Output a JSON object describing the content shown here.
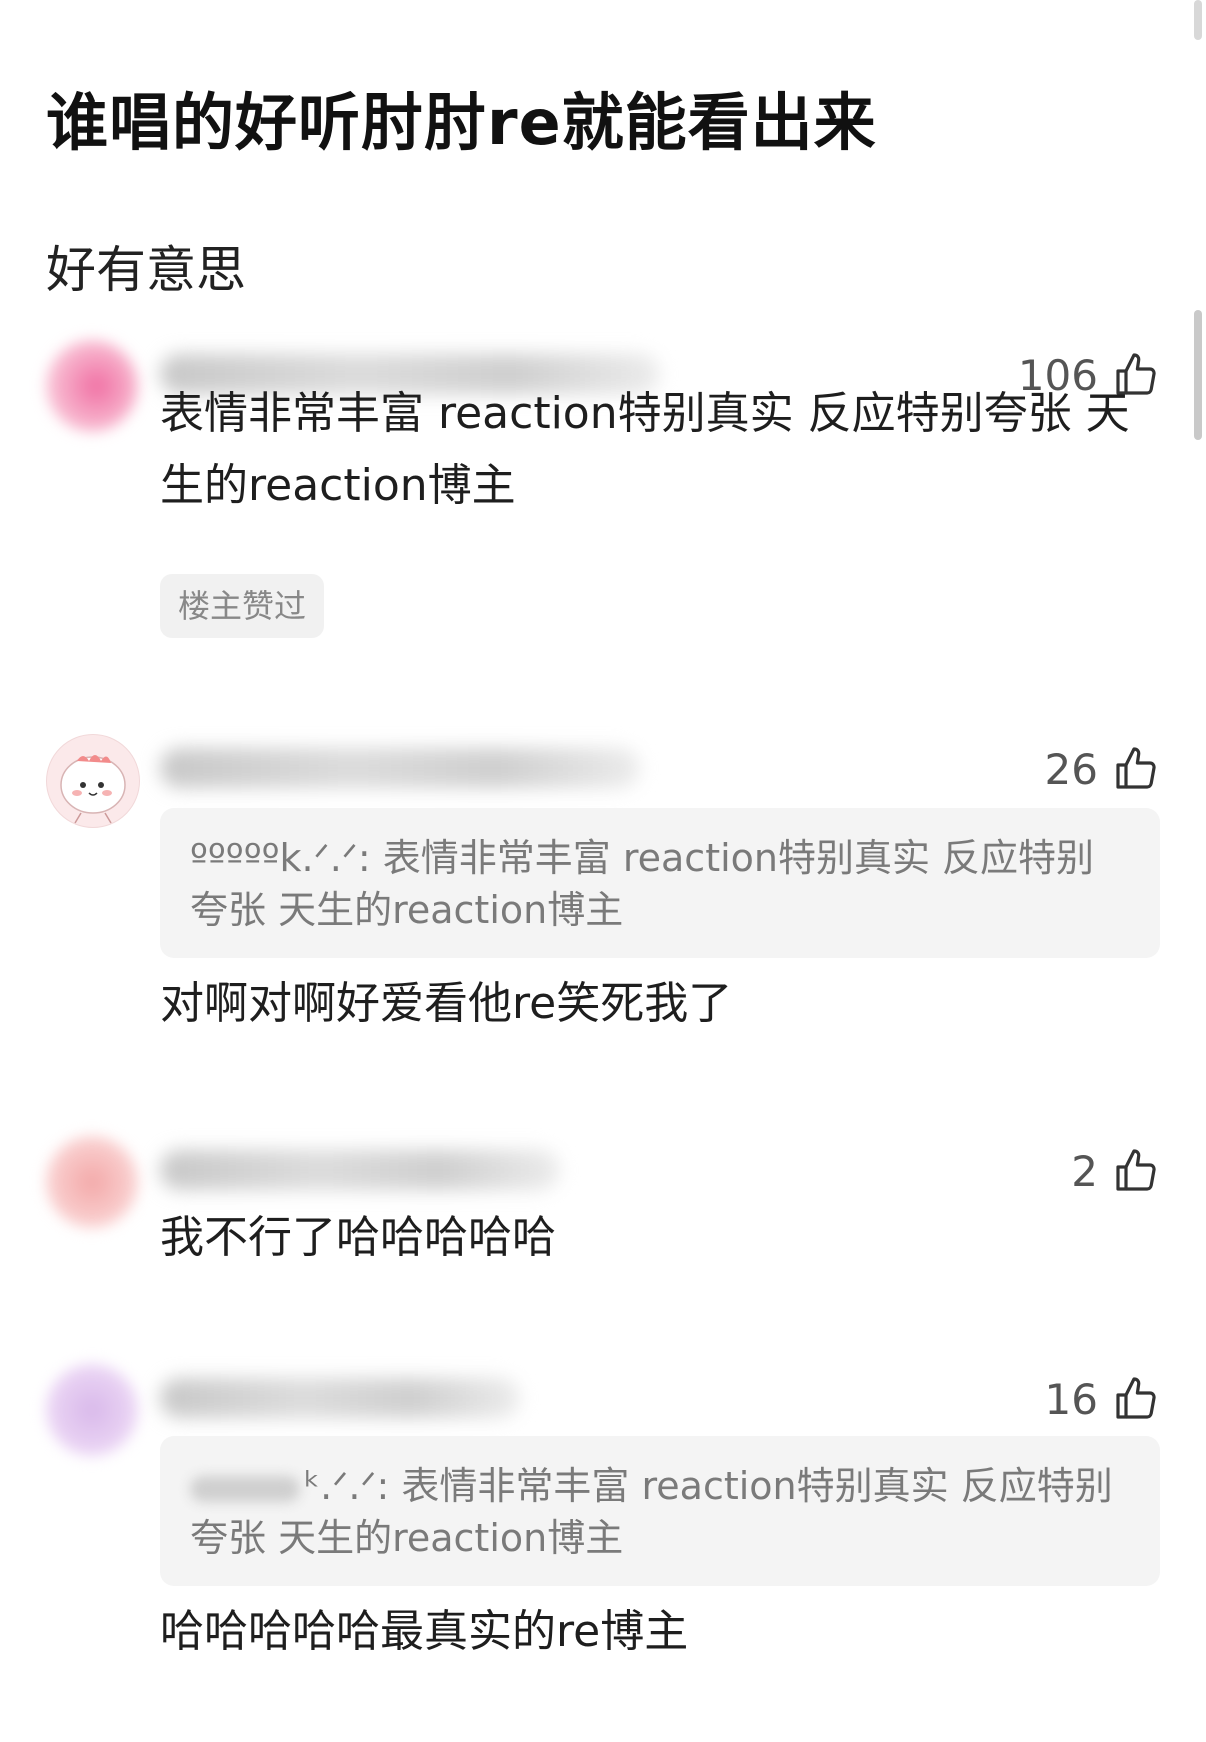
{
  "post": {
    "title": "谁唱的好听肘肘re就能看出来",
    "subtitle": "好有意思"
  },
  "comments": [
    {
      "likes": "106",
      "text": "表情非常丰富 reaction特别真实 反应特别夸张 天生的reaction博主",
      "tag": "楼主赞过"
    },
    {
      "likes": "26",
      "quote_author": "ºººººk.ᐟ.ᐟ:",
      "quote_text": "表情非常丰富 reaction特别真实 反应特别夸张 天生的reaction博主",
      "text": "对啊对啊好爱看他re笑死我了"
    },
    {
      "likes": "2",
      "text": "我不行了哈哈哈哈哈"
    },
    {
      "likes": "16",
      "quote_author": "ᵏ.ᐟ.ᐟ:",
      "quote_text": "表情非常丰富 reaction特别真实 反应特别夸张 天生的reaction博主",
      "text": "哈哈哈哈哈最真实的re博主"
    }
  ],
  "icons": {
    "like": "thumbs-up-icon"
  },
  "colors": {
    "background": "#ffffff",
    "quote_bg": "#f4f4f4",
    "tag_bg": "#f1f1f1",
    "muted_text": "#7a7a7a"
  }
}
